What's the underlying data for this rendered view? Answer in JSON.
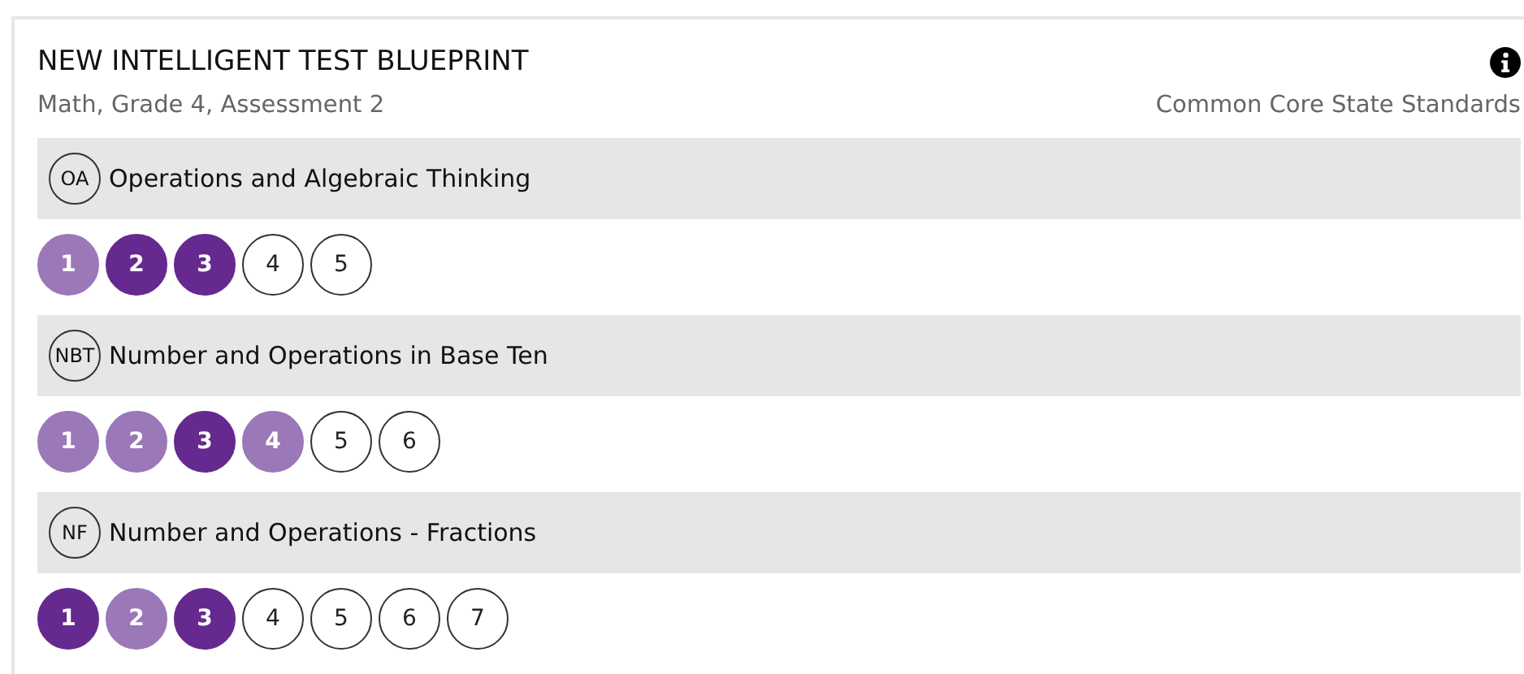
{
  "title": "NEW INTELLIGENT TEST BLUEPRINT",
  "subtitle": "Math, Grade 4, Assessment 2",
  "standards": "Common Core State Standards",
  "domains": [
    {
      "code": "OA",
      "name": "Operations and Algebraic Thinking",
      "items": [
        {
          "label": "1",
          "kind": "partial"
        },
        {
          "label": "2",
          "kind": "full"
        },
        {
          "label": "3",
          "kind": "full"
        },
        {
          "label": "4",
          "kind": "empty"
        },
        {
          "label": "5",
          "kind": "empty"
        }
      ]
    },
    {
      "code": "NBT",
      "name": "Number and Operations in Base Ten",
      "items": [
        {
          "label": "1",
          "kind": "partial"
        },
        {
          "label": "2",
          "kind": "partial"
        },
        {
          "label": "3",
          "kind": "full"
        },
        {
          "label": "4",
          "kind": "partial"
        },
        {
          "label": "5",
          "kind": "empty"
        },
        {
          "label": "6",
          "kind": "empty"
        }
      ]
    },
    {
      "code": "NF",
      "name": "Number and Operations - Fractions",
      "items": [
        {
          "label": "1",
          "kind": "full"
        },
        {
          "label": "2",
          "kind": "partial"
        },
        {
          "label": "3",
          "kind": "full"
        },
        {
          "label": "4",
          "kind": "empty"
        },
        {
          "label": "5",
          "kind": "empty"
        },
        {
          "label": "6",
          "kind": "empty"
        },
        {
          "label": "7",
          "kind": "empty"
        }
      ]
    }
  ]
}
